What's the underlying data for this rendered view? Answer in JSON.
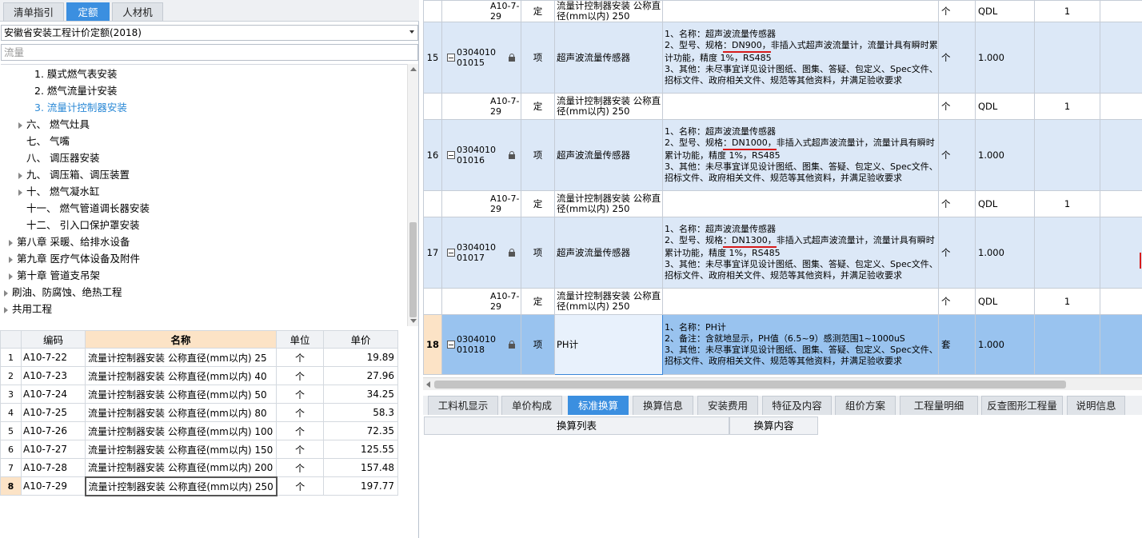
{
  "left_tabs": [
    "清单指引",
    "定额",
    "人材机"
  ],
  "library_select": "安徽省安装工程计价定额(2018)",
  "search_value": "流量",
  "tree": [
    {
      "label": "1. 膜式燃气表安装",
      "sel": false
    },
    {
      "label": "2. 燃气流量计安装",
      "sel": false
    },
    {
      "label": "3. 流量计控制器安装",
      "sel": true
    },
    {
      "label": "六、 燃气灶具",
      "sel": false
    },
    {
      "label": "七、 气嘴",
      "sel": false
    },
    {
      "label": "八、 调压器安装",
      "sel": false
    },
    {
      "label": "九、 调压箱、调压装置",
      "sel": false
    },
    {
      "label": "十、 燃气凝水缸",
      "sel": false
    },
    {
      "label": "十一、 燃气管道调长器安装",
      "sel": false
    },
    {
      "label": "十二、 引入口保护罩安装",
      "sel": false
    },
    {
      "label": "第八章 采暖、给排水设备",
      "sel": false
    },
    {
      "label": "第九章 医疗气体设备及附件",
      "sel": false
    },
    {
      "label": "第十章 管道支吊架",
      "sel": false
    },
    {
      "label": "刷油、防腐蚀、绝热工程",
      "sel": false
    },
    {
      "label": "共用工程",
      "sel": false
    }
  ],
  "quota_table": {
    "headers": [
      "编码",
      "名称",
      "单位",
      "单价"
    ],
    "rows": [
      {
        "n": "1",
        "code": "A10-7-22",
        "name": "流量计控制器安装 公称直径(mm以内) 25",
        "unit": "个",
        "price": "19.89"
      },
      {
        "n": "2",
        "code": "A10-7-23",
        "name": "流量计控制器安装 公称直径(mm以内) 40",
        "unit": "个",
        "price": "27.96"
      },
      {
        "n": "3",
        "code": "A10-7-24",
        "name": "流量计控制器安装 公称直径(mm以内) 50",
        "unit": "个",
        "price": "34.25"
      },
      {
        "n": "4",
        "code": "A10-7-25",
        "name": "流量计控制器安装 公称直径(mm以内) 80",
        "unit": "个",
        "price": "58.3"
      },
      {
        "n": "5",
        "code": "A10-7-26",
        "name": "流量计控制器安装 公称直径(mm以内) 100",
        "unit": "个",
        "price": "72.35"
      },
      {
        "n": "6",
        "code": "A10-7-27",
        "name": "流量计控制器安装 公称直径(mm以内) 150",
        "unit": "个",
        "price": "125.55"
      },
      {
        "n": "7",
        "code": "A10-7-28",
        "name": "流量计控制器安装 公称直径(mm以内) 200",
        "unit": "个",
        "price": "157.48"
      },
      {
        "n": "8",
        "code": "A10-7-29",
        "name": "流量计控制器安装 公称直径(mm以内) 250",
        "unit": "个",
        "price": "197.77"
      }
    ]
  },
  "grid_rows": [
    {
      "kind": "sub",
      "num": "",
      "code": "A10-7-29",
      "type": "定",
      "name": "流量计控制器安装 公称直径(mm以内) 250",
      "feat": [],
      "unit": "个",
      "qty": "QDL",
      "q2": "1"
    },
    {
      "kind": "main",
      "num": "15",
      "code1": "0304010",
      "code2": "01015",
      "type": "项",
      "name": "超声波流量传感器",
      "feat": [
        "1、名称：超声波流量传感器",
        "2、型号、规格：DN900，非插入式超声波流量计，流量计具有瞬时累计功能，精度 1%，RS485",
        "3、其他：未尽事宜详见设计图纸、图集、答疑、包定义、Spec文件、招标文件、政府相关文件、规范等其他资料，并满足验收要求"
      ],
      "unit": "个",
      "qty": "1.000",
      "q2": ""
    },
    {
      "kind": "sub",
      "num": "",
      "code": "A10-7-29",
      "type": "定",
      "name": "流量计控制器安装 公称直径(mm以内) 250",
      "feat": [],
      "unit": "个",
      "qty": "QDL",
      "q2": "1"
    },
    {
      "kind": "main",
      "num": "16",
      "code1": "0304010",
      "code2": "01016",
      "type": "项",
      "name": "超声波流量传感器",
      "feat": [
        "1、名称：超声波流量传感器",
        "2、型号、规格：DN1000，非插入式超声波流量计，流量计具有瞬时累计功能，精度 1%，RS485",
        "3、其他：未尽事宜详见设计图纸、图集、答疑、包定义、Spec文件、招标文件、政府相关文件、规范等其他资料，并满足验收要求"
      ],
      "unit": "个",
      "qty": "1.000",
      "q2": ""
    },
    {
      "kind": "sub",
      "num": "",
      "code": "A10-7-29",
      "type": "定",
      "name": "流量计控制器安装 公称直径(mm以内) 250",
      "feat": [],
      "unit": "个",
      "qty": "QDL",
      "q2": "1"
    },
    {
      "kind": "main",
      "num": "17",
      "code1": "0304010",
      "code2": "01017",
      "type": "项",
      "name": "超声波流量传感器",
      "feat": [
        "1、名称：超声波流量传感器",
        "2、型号、规格：DN1300，非插入式超声波流量计，流量计具有瞬时累计功能，精度 1%，RS485",
        "3、其他：未尽事宜详见设计图纸、图集、答疑、包定义、Spec文件、招标文件、政府相关文件、规范等其他资料，并满足验收要求"
      ],
      "unit": "个",
      "qty": "1.000",
      "q2": ""
    },
    {
      "kind": "sub",
      "num": "",
      "code": "A10-7-29",
      "type": "定",
      "name": "流量计控制器安装 公称直径(mm以内) 250",
      "feat": [],
      "unit": "个",
      "qty": "QDL",
      "q2": "1"
    },
    {
      "kind": "sel",
      "num": "18",
      "code1": "0304010",
      "code2": "01018",
      "type": "项",
      "name": "PH计",
      "feat": [
        "1、名称：PH计",
        "2、备注：含就地显示，PH值（6.5~9）感测范围1~1000uS",
        "3、其他：未尽事宜详见设计图纸、图集、答疑、包定义、Spec文件、招标文件、政府相关文件、规范等其他资料，并满足验收要求"
      ],
      "unit": "套",
      "qty": "1.000",
      "q2": ""
    }
  ],
  "bottom_tabs": [
    "工料机显示",
    "单价构成",
    "标准换算",
    "换算信息",
    "安装费用",
    "特征及内容",
    "组价方案",
    "工程量明细",
    "反查图形工程量",
    "说明信息"
  ],
  "conversion_headers": [
    "换算列表",
    "换算内容"
  ]
}
